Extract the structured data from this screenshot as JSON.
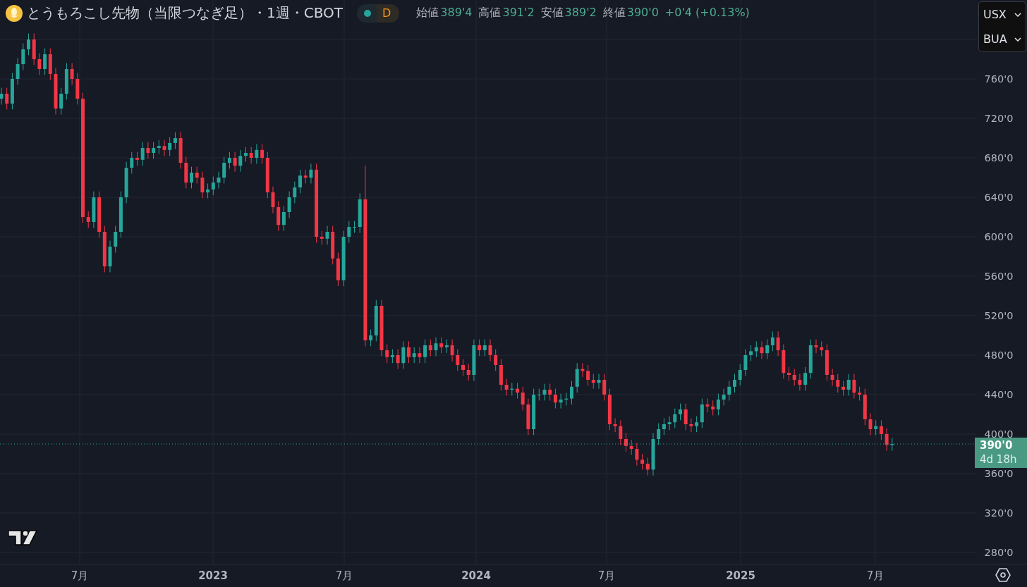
{
  "header": {
    "title": "とうもろこし先物（当限つなぎ足）・1週・CBOT",
    "status_dot": {
      "color": "#26a69a"
    },
    "status_letter": "D",
    "ohlc": [
      {
        "label": "始値",
        "value": "389'4"
      },
      {
        "label": "高値",
        "value": "391'2"
      },
      {
        "label": "安値",
        "value": "389'2"
      },
      {
        "label": "終値",
        "value": "390'0"
      }
    ],
    "change": "+0'4 (+0.13%)"
  },
  "unit_selectors": [
    "USX",
    "BUA"
  ],
  "price_axis": {
    "labels": [
      "760'0",
      "720'0",
      "680'0",
      "640'0",
      "600'0",
      "560'0",
      "520'0",
      "480'0",
      "440'0",
      "400'0",
      "360'0",
      "320'0",
      "280'0"
    ]
  },
  "price_label": {
    "value": "390'0",
    "countdown": "4d 18h"
  },
  "time_axis": {
    "labels": [
      {
        "text": "7月",
        "kind": "month"
      },
      {
        "text": "2023",
        "kind": "year"
      },
      {
        "text": "7月",
        "kind": "month"
      },
      {
        "text": "2024",
        "kind": "year"
      },
      {
        "text": "7月",
        "kind": "month"
      },
      {
        "text": "2025",
        "kind": "year"
      },
      {
        "text": "7月",
        "kind": "month"
      }
    ]
  }
}
